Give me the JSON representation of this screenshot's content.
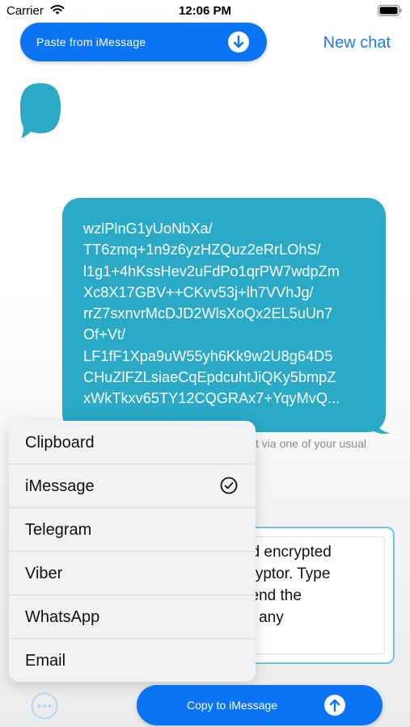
{
  "status_bar": {
    "carrier": "Carrier",
    "time": "12:06 PM"
  },
  "header": {
    "paste_button_label": "Paste from  iMessage",
    "new_chat_label": "New chat"
  },
  "message": {
    "lines": "wzlPlnG1yUoNbXa/\nTT6zmq+1n9z6yzHZQuz2eRrLOhS/\nl1g1+4hKssHev2uFdPo1qrPW7wdpZm\nXc8X17GBV++CKvv53j+lh7VVhJg/\nrrZ7sxnvrMcDJD2WlsXoQx2EL5uUn7\nOf+Vt/\nLF1fF1Xpa9uW55yh6Kk9w2U8g64D5\nCHuZlFZLsiaeCqEpdcuhtJiQKy5bmpZ\nxWkTkxv65TY12CQGRAx7+YqyMvQ..."
  },
  "hint": {
    "text": "t via one of your usual"
  },
  "compose": {
    "text": "nd encrypted\ncryptor. Type\nsend the\nia any"
  },
  "menu": {
    "items": [
      {
        "label": "Clipboard",
        "selected": false
      },
      {
        "label": "iMessage",
        "selected": true
      },
      {
        "label": "Telegram",
        "selected": false
      },
      {
        "label": "Viber",
        "selected": false
      },
      {
        "label": "WhatsApp",
        "selected": false
      },
      {
        "label": "Email",
        "selected": false
      }
    ]
  },
  "footer": {
    "copy_button_label": "Copy to iMessage"
  },
  "icons": {
    "wifi": "wifi-icon",
    "battery": "battery-icon",
    "download": "arrow-down-icon",
    "logo": "speech-bubble-icon",
    "check": "checkmark-circle-icon",
    "more": "ellipsis-circle-icon",
    "upload": "arrow-up-icon"
  },
  "colors": {
    "accent": "#0b74f4",
    "bubble": "#2aaac7",
    "compose_border": "#6cc7df"
  }
}
